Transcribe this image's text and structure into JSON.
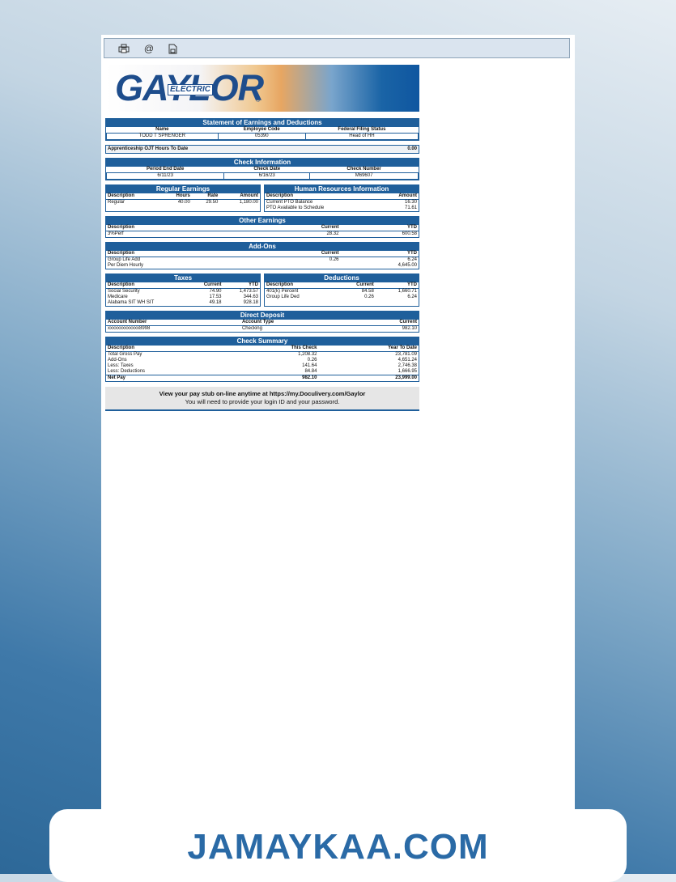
{
  "toolbar": {
    "icons": [
      "print-icon",
      "email-icon",
      "save-icon"
    ]
  },
  "logo": {
    "main": "GAYLOR",
    "sub": "ELECTRIC",
    "reg": "®"
  },
  "statement": {
    "title": "Statement of Earnings and Deductions",
    "headers": [
      "Name",
      "Employee Code",
      "Federal Filing Status"
    ],
    "values": [
      "TODD T SPRENGER",
      "05390",
      "Head of HH"
    ]
  },
  "ojt": {
    "label": "Apprenticeship OJT Hours To Date",
    "value": "0.00"
  },
  "check_info": {
    "title": "Check Information",
    "headers": [
      "Period End Date",
      "Check Date",
      "Check Number"
    ],
    "values": [
      "6/11/23",
      "6/16/23",
      "M69607"
    ]
  },
  "regular_earnings": {
    "title": "Regular Earnings",
    "headers": [
      "Description",
      "Hours",
      "Rate",
      "Amount"
    ],
    "rows": [
      [
        "Regular",
        "40.00",
        "29.50",
        "1,180.00"
      ]
    ]
  },
  "hr_info": {
    "title": "Human Resources Information",
    "headers": [
      "Description",
      "Amount"
    ],
    "rows": [
      [
        "Current PTO Balance",
        "16.30"
      ],
      [
        "PTO Available to Schedule",
        "71.61"
      ]
    ]
  },
  "other_earnings": {
    "title": "Other Earnings",
    "headers": [
      "Description",
      "Current",
      "YTD"
    ],
    "rows": [
      [
        "3%Perf",
        "28.32",
        "600.58"
      ]
    ]
  },
  "add_ons": {
    "title": "Add-Ons",
    "headers": [
      "Description",
      "Current",
      "YTD"
    ],
    "rows": [
      [
        "Group Life Add",
        "0.26",
        "6.24"
      ],
      [
        "Per Diem Hourly",
        "",
        "4,645.00"
      ]
    ]
  },
  "taxes": {
    "title": "Taxes",
    "headers": [
      "Description",
      "Current",
      "YTD"
    ],
    "rows": [
      [
        "Social Security",
        "74.90",
        "1,473.57"
      ],
      [
        "Medicare",
        "17.53",
        "344.63"
      ],
      [
        "Alabama SIT WH SIT",
        "49.18",
        "928.18"
      ]
    ]
  },
  "deductions": {
    "title": "Deductions",
    "headers": [
      "Description",
      "Current",
      "YTD"
    ],
    "rows": [
      [
        "401(k) Percent",
        "84.58",
        "1,660.71"
      ],
      [
        "Group Life Ded",
        "0.26",
        "6.24"
      ]
    ]
  },
  "direct_deposit": {
    "title": "Direct Deposit",
    "headers": [
      "Account Number",
      "Account Type",
      "Current"
    ],
    "rows": [
      [
        "xxxxxxxxxxxxx8998",
        "Checking",
        "982.10"
      ]
    ]
  },
  "check_summary": {
    "title": "Check Summary",
    "headers": [
      "Description",
      "This Check",
      "Year To Date"
    ],
    "rows": [
      [
        "Total Gross Pay",
        "1,208.32",
        "23,781.09"
      ],
      [
        "Add-Ons",
        "0.26",
        "4,651.24"
      ],
      [
        "Less: Taxes",
        "141.64",
        "2,746.38"
      ],
      [
        "Less: Deductions",
        "84.84",
        "1,666.95"
      ]
    ],
    "net": [
      "Net Pay",
      "982.10",
      "23,999.00"
    ]
  },
  "footer": {
    "line1": "View your pay stub on-line anytime at https://my.Doculivery.com/Gaylor",
    "line2": "You will need to provide your login ID and your password."
  },
  "watermark": "JAMAYKAA.COM"
}
